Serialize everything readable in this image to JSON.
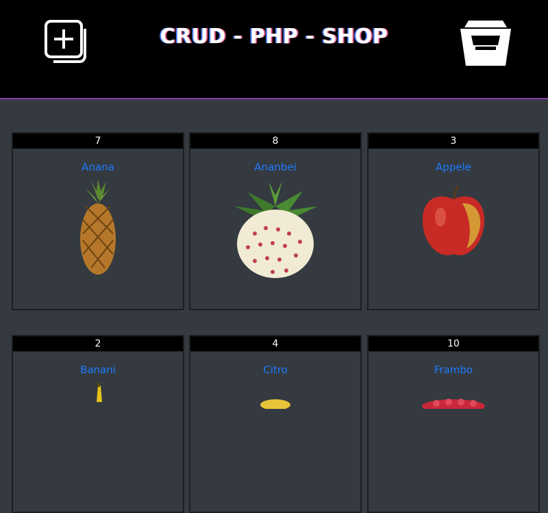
{
  "header": {
    "title": "CRUD - PHP - SHOP",
    "add_icon": "add-product-icon",
    "cart_icon": "shopping-cart-icon"
  },
  "products": [
    {
      "qty": "7",
      "name": "Anana",
      "image": "pineapple"
    },
    {
      "qty": "8",
      "name": "Ananbei",
      "image": "pineberry"
    },
    {
      "qty": "3",
      "name": "Appele",
      "image": "apple"
    },
    {
      "qty": "2",
      "name": "Banani",
      "image": "banana"
    },
    {
      "qty": "4",
      "name": "Citro",
      "image": "lemon"
    },
    {
      "qty": "10",
      "name": "Frambo",
      "image": "raspberry"
    }
  ],
  "colors": {
    "background": "#343a40",
    "header": "#000000",
    "link": "#1e7bff",
    "accent_border": "#8a3aa8"
  }
}
